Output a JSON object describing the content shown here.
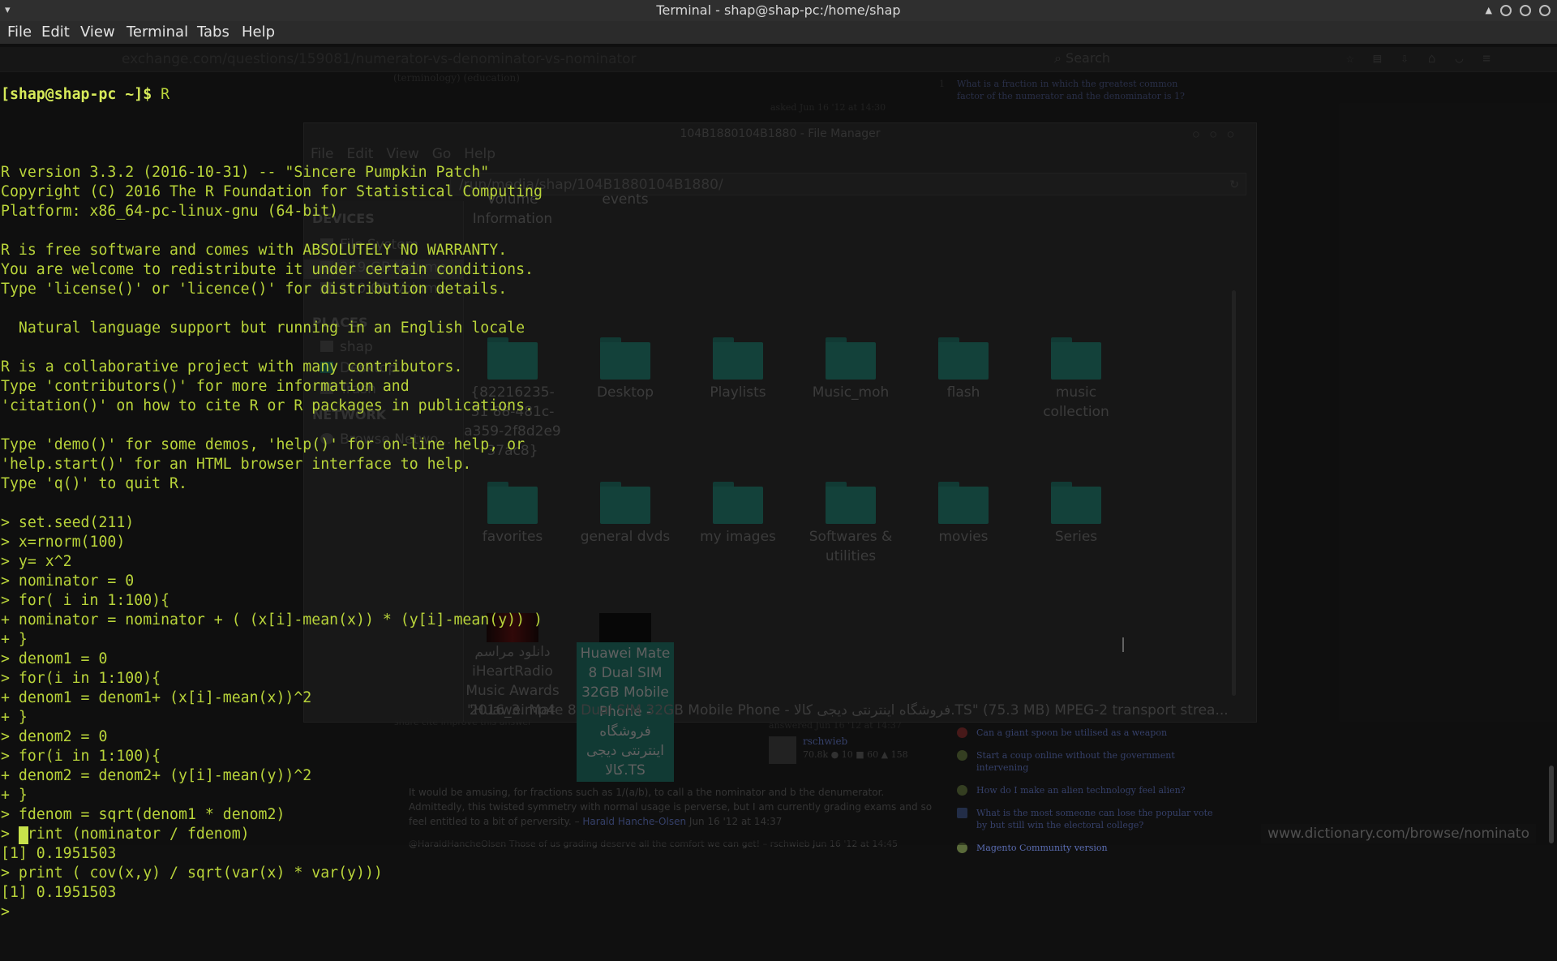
{
  "background_browser": {
    "url": "exchange.com/questions/159081/numerator-vs-denominator-vs-nominator",
    "search_placeholder": "Search",
    "tags": "(terminology) (education)",
    "asked": "asked Jun 16 '12 at 14:30",
    "related_top_number": "1",
    "related_top": "What is a fraction in which the greatest common factor of the numerator and the denominator is 1?",
    "share": "share cite improve this answer",
    "answered": "answered Jun 16 '12 at 14:37",
    "answer_user": "rschwieb",
    "answer_rep": "70.8k ● 10 ■ 60 ▲ 158",
    "related_list": [
      "Can a giant spoon be utilised as a weapon",
      "Start a coup online without the government intervening",
      "How do I make an alien technology feel alien?",
      "What is the most someone can lose the popular vote by but still win the electoral college?",
      "Magento Community version"
    ],
    "comment_line1": "It would be amusing, for fractions such as 1/(a/b), to call a the nominator and b the denumerator.",
    "comment_line2": "Admittedly, this twisted symmetry with normal usage is perverse, but I am currently grading exams and so",
    "comment_line3_prefix": "feel entitled to a bit of perversity. –",
    "comment_author": "Harald Hanche-Olsen",
    "comment_time": "Jun 16 '12 at 14:37",
    "comment2": "@HaraldHancheOlsen Those of us grading deserve all the comfort we can get! – rschwieb Jun 16 '12 at 14:45",
    "status_url": "www.dictionary.com/browse/nominato"
  },
  "file_manager": {
    "title": "104B1880104B1880 - File Manager",
    "menu": [
      "File",
      "Edit",
      "View",
      "Go",
      "Help"
    ],
    "path": "/run/media/shap/104B1880104B1880/",
    "sections": {
      "devices": "DEVICES",
      "places": "PLACES",
      "network": "NETWORK"
    },
    "devices": [
      "File System",
      "219 GB Volume",
      "110 GB Volume"
    ],
    "places": [
      "shap",
      "Desktop",
      "Trash"
    ],
    "network": [
      "Browse Netwo..."
    ],
    "items": [
      "Volume Information",
      "events",
      "{82216235-31 88-481c-a359-2f8d2e9 37ac8}",
      "Desktop",
      "Playlists",
      "Music_moh",
      "flash",
      "music collection",
      "favorites",
      "general dvds",
      "my images",
      "Softwares & utilities",
      "movies",
      "Series",
      "دانلود مراسم iHeartRadio Music Awards 2016_3.mp4",
      "Huawei Mate 8 Dual SIM 32GB Mobile Phone - فروشگاه اینترنتی دیجی کالا.TS"
    ],
    "status": "\"Huawei Mate 8 Dual SIM 32GB Mobile Phone - فروشگاه اینترنتی دیجی کالا.TS\" (75.3 MB) MPEG-2 transport strea..."
  },
  "terminal": {
    "title": "Terminal - shap@shap-pc:/home/shap",
    "menu": [
      "File",
      "Edit",
      "View",
      "Terminal",
      "Tabs",
      "Help"
    ],
    "prompt": "[shap@shap-pc ~]$",
    "command": " R",
    "lines": [
      "",
      "R version 3.3.2 (2016-10-31) -- \"Sincere Pumpkin Patch\"",
      "Copyright (C) 2016 The R Foundation for Statistical Computing",
      "Platform: x86_64-pc-linux-gnu (64-bit)",
      "",
      "R is free software and comes with ABSOLUTELY NO WARRANTY.",
      "You are welcome to redistribute it under certain conditions.",
      "Type 'license()' or 'licence()' for distribution details.",
      "",
      "  Natural language support but running in an English locale",
      "",
      "R is a collaborative project with many contributors.",
      "Type 'contributors()' for more information and",
      "'citation()' on how to cite R or R packages in publications.",
      "",
      "Type 'demo()' for some demos, 'help()' for on-line help, or",
      "'help.start()' for an HTML browser interface to help.",
      "Type 'q()' to quit R.",
      "",
      "> set.seed(211)",
      "> x=rnorm(100)",
      "> y= x^2",
      "> nominator = 0",
      "> for( i in 1:100){",
      "+ nominator = nominator + ( (x[i]-mean(x)) * (y[i]-mean(y)) )",
      "+ }",
      "> denom1 = 0",
      "> for(i in 1:100){",
      "+ denom1 = denom1+ (x[i]-mean(x))^2",
      "+ }",
      "> denom2 = 0",
      "> for(i in 1:100){",
      "+ denom2 = denom2+ (y[i]-mean(y))^2",
      "+ }",
      "> fdenom = sqrt(denom1 * denom2)",
      "> print (nominator / fdenom)",
      "[1] 0.1951503",
      "> print ( cov(x,y) / sqrt(var(x) * var(y)))",
      "[1] 0.1951503",
      "> "
    ]
  }
}
